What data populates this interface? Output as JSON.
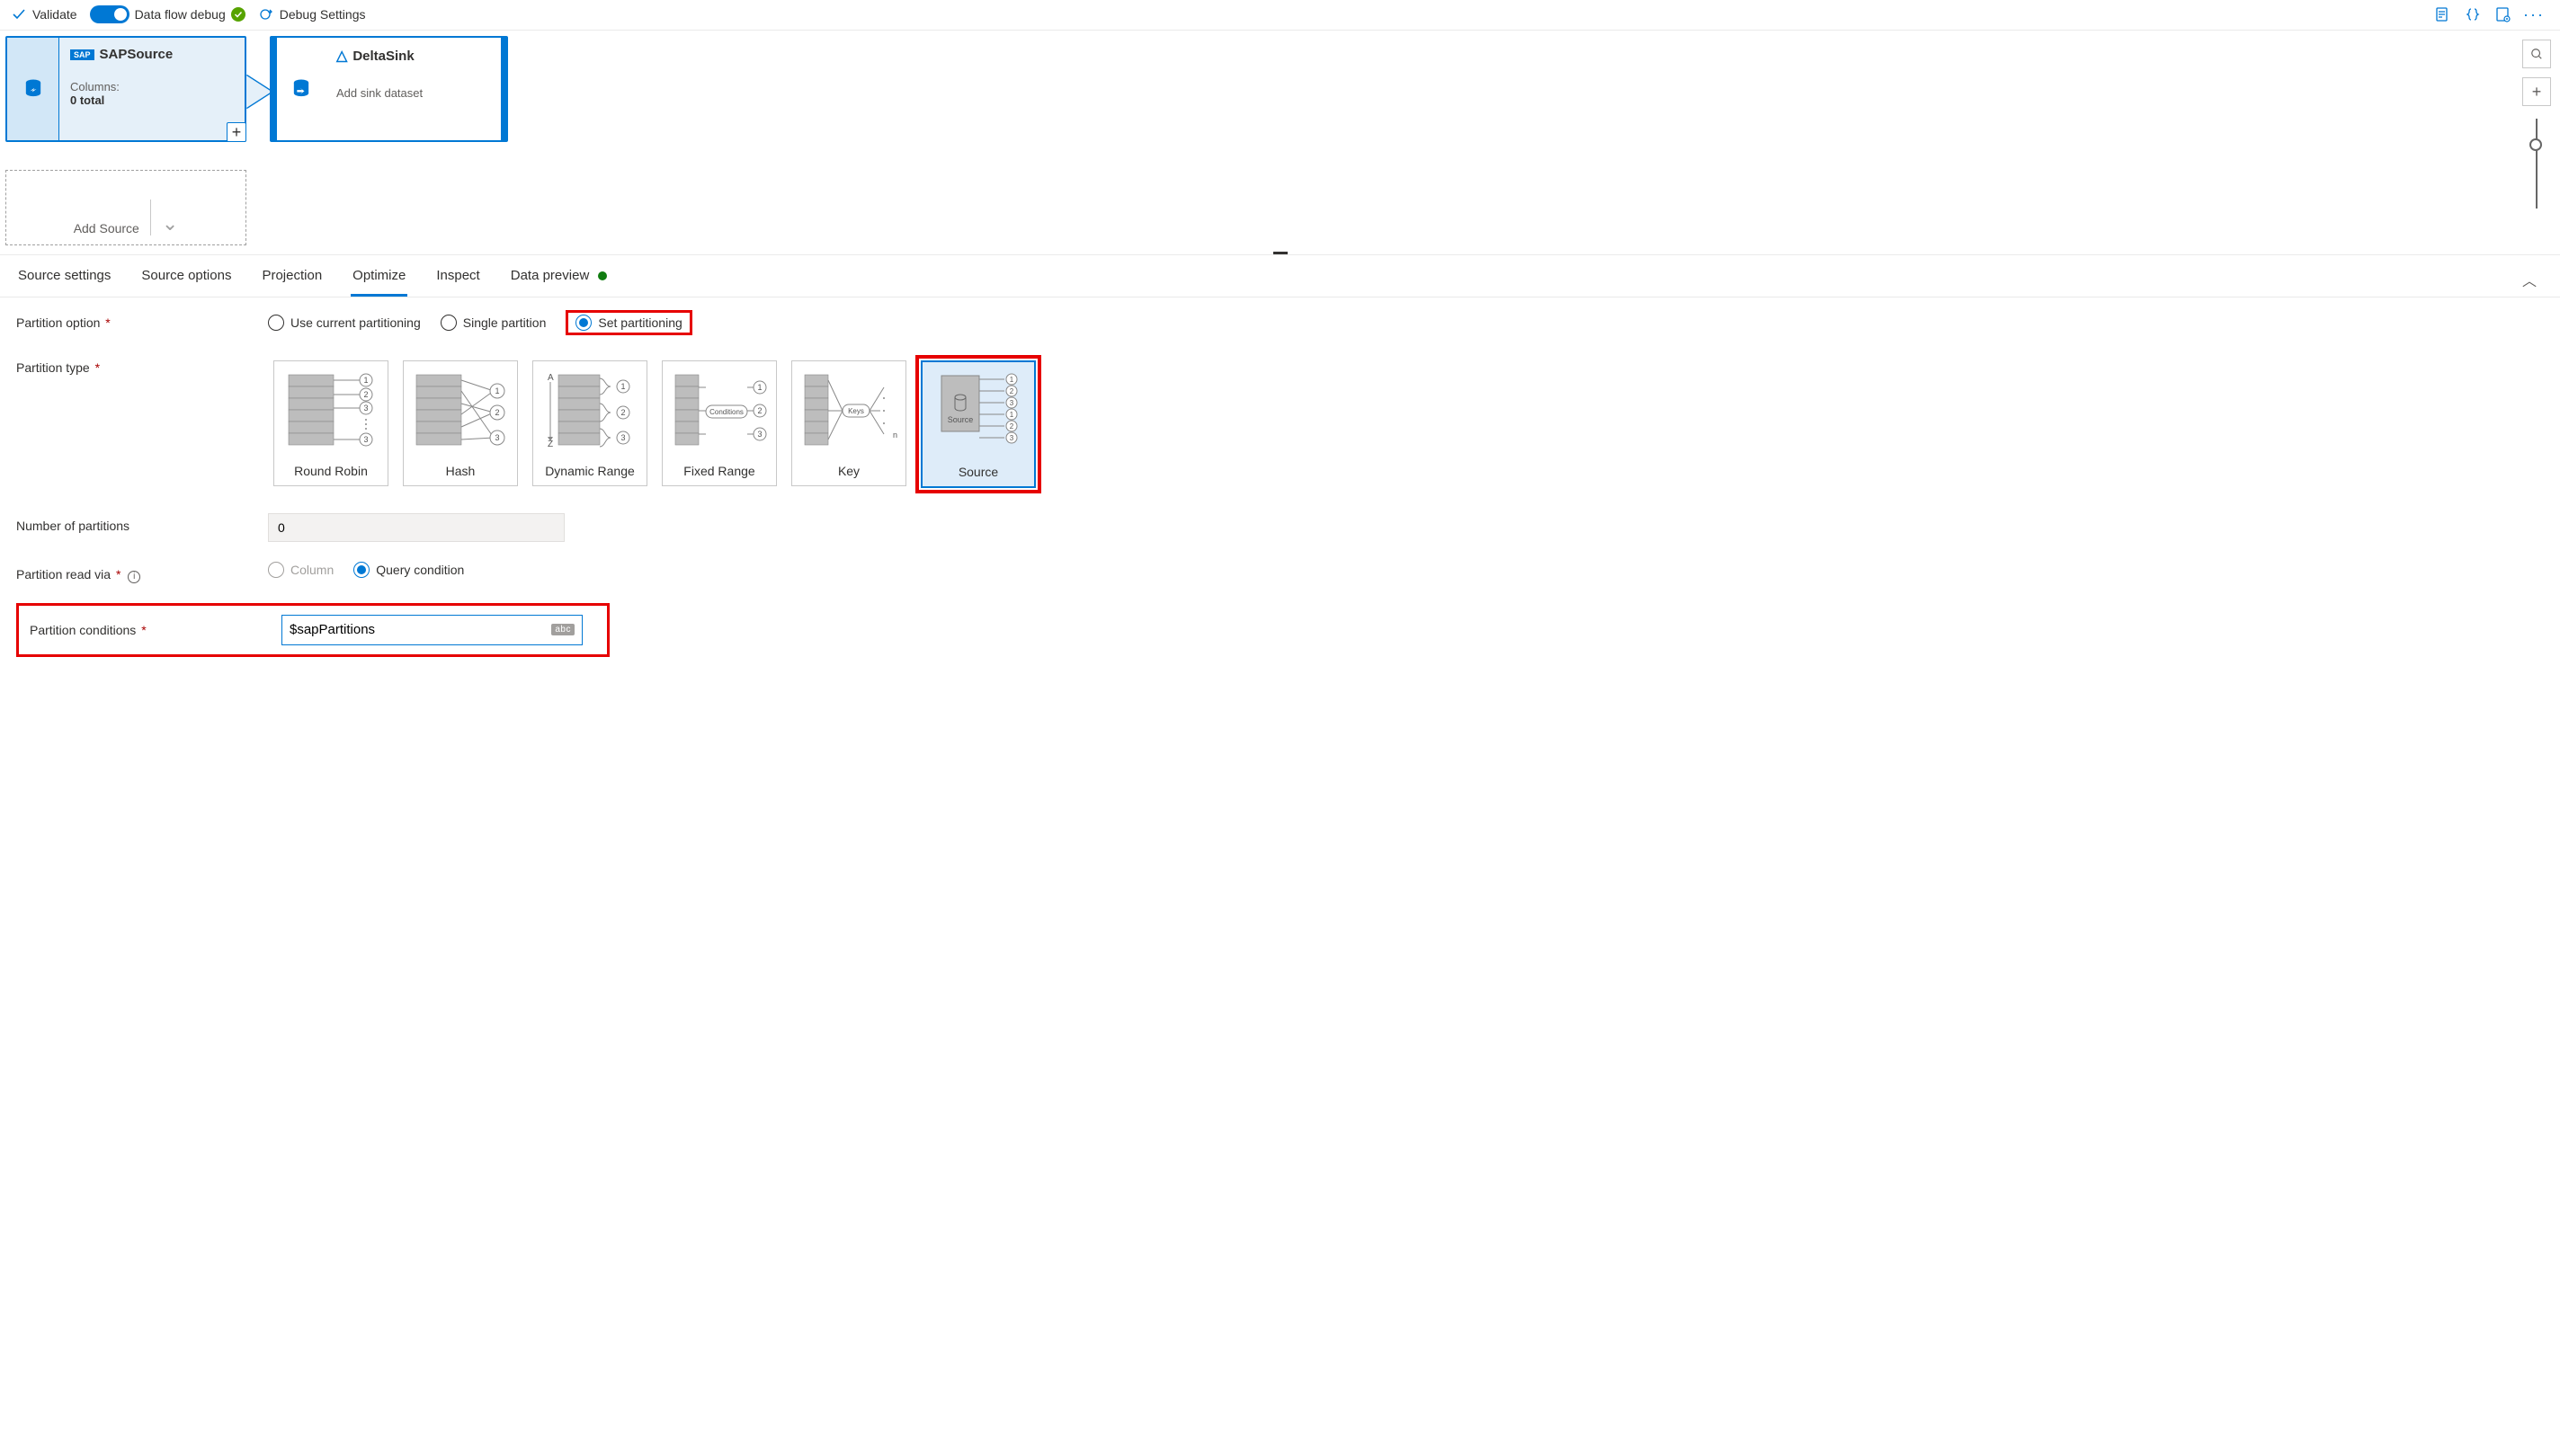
{
  "toolbar": {
    "validate": "Validate",
    "debug_toggle_label": "Data flow debug",
    "debug_settings": "Debug Settings"
  },
  "canvas": {
    "source": {
      "title": "SAPSource",
      "columns_label": "Columns:",
      "columns_count": "0 total"
    },
    "sink": {
      "title": "DeltaSink",
      "subtitle": "Add sink dataset"
    },
    "add_source": "Add Source"
  },
  "tabs": [
    "Source settings",
    "Source options",
    "Projection",
    "Optimize",
    "Inspect",
    "Data preview"
  ],
  "active_tab": "Optimize",
  "form": {
    "partition_option_label": "Partition option",
    "partition_options": [
      "Use current partitioning",
      "Single partition",
      "Set partitioning"
    ],
    "partition_type_label": "Partition type",
    "partition_types": [
      "Round Robin",
      "Hash",
      "Dynamic Range",
      "Fixed Range",
      "Key",
      "Source"
    ],
    "num_partitions_label": "Number of partitions",
    "num_partitions_value": "0",
    "partition_read_via_label": "Partition read via",
    "partition_read_via": [
      "Column",
      "Query condition"
    ],
    "partition_conditions_label": "Partition conditions",
    "partition_conditions_value": "$sapPartitions",
    "abc": "abc"
  }
}
